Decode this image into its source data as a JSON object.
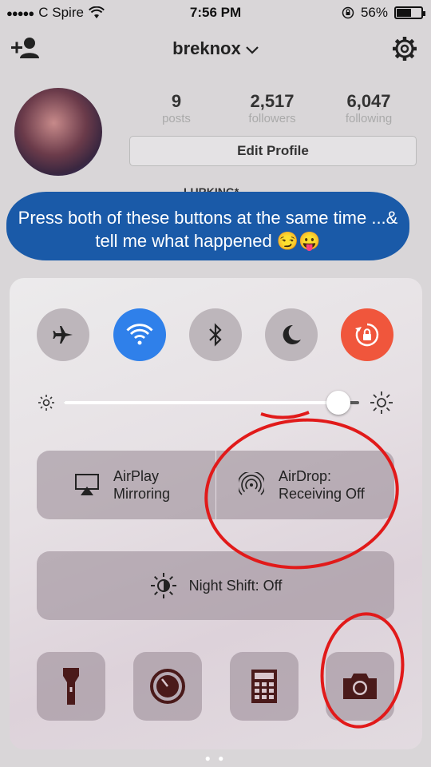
{
  "status_bar": {
    "carrier": "C Spire",
    "time": "7:56 PM",
    "battery": "56%",
    "battery_level": 0.56
  },
  "profile": {
    "username": "breknox",
    "stats": [
      {
        "value": "9",
        "label": "posts"
      },
      {
        "value": "2,517",
        "label": "followers"
      },
      {
        "value": "6,047",
        "label": "following"
      }
    ],
    "edit_button": "Edit Profile",
    "bio_partial": "LURKING*"
  },
  "annotation": {
    "caption": "Press both of these buttons at the same time ...& tell me what happened 😏😛"
  },
  "control_center": {
    "toggles": [
      {
        "name": "airplane-mode",
        "icon": "airplane-icon",
        "active": false
      },
      {
        "name": "wifi",
        "icon": "wifi-icon",
        "active": true
      },
      {
        "name": "bluetooth",
        "icon": "bluetooth-icon",
        "active": false
      },
      {
        "name": "do-not-disturb",
        "icon": "moon-icon",
        "active": false
      },
      {
        "name": "rotation-lock",
        "icon": "rotation-lock-icon",
        "active": true
      }
    ],
    "brightness": 0.93,
    "airplay": {
      "line1": "AirPlay",
      "line2": "Mirroring"
    },
    "airdrop": {
      "line1": "AirDrop:",
      "line2": "Receiving Off"
    },
    "night_shift": "Night Shift: Off",
    "apps": [
      "flashlight-icon",
      "timer-icon",
      "calculator-icon",
      "camera-icon"
    ],
    "colors": {
      "wifi_active": "#2f80ea",
      "rotation_active": "#f0563c",
      "annotation_red": "#e11a1a",
      "caption_bg": "#1a5aa8"
    }
  }
}
